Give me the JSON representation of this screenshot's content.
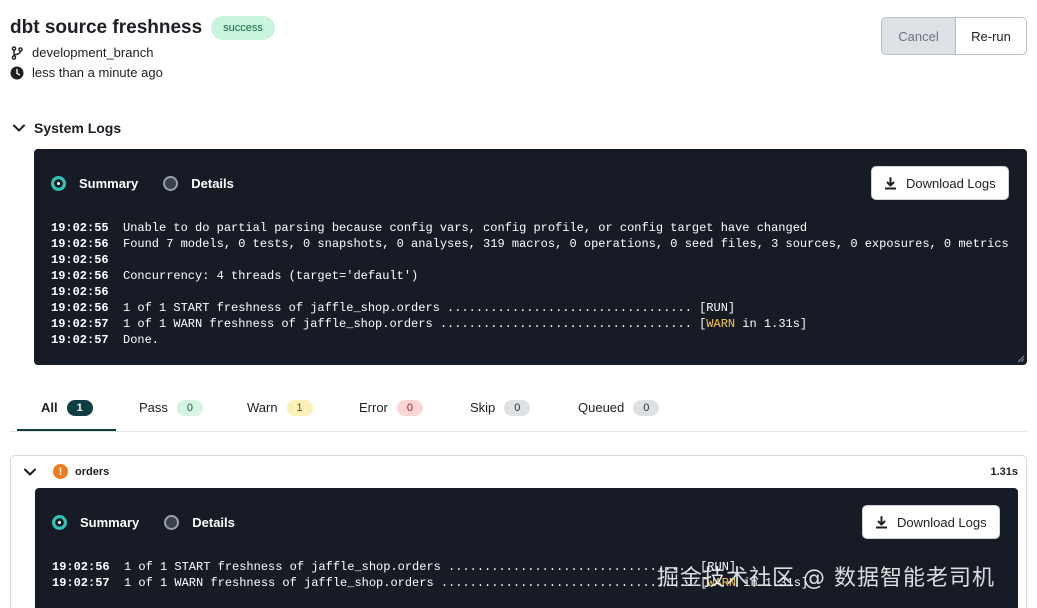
{
  "header": {
    "title": "dbt source freshness",
    "status": "success",
    "branch": "development_branch",
    "time": "less than a minute ago"
  },
  "actions": {
    "cancel_label": "Cancel",
    "rerun_label": "Re-run"
  },
  "system_logs": {
    "title": "System Logs",
    "summary_label": "Summary",
    "details_label": "Details",
    "download_label": "Download Logs",
    "lines": [
      {
        "ts": "19:02:55",
        "msg": "Unable to do partial parsing because config vars, config profile, or config target have changed"
      },
      {
        "ts": "19:02:56",
        "msg": "Found 7 models, 0 tests, 0 snapshots, 0 analyses, 319 macros, 0 operations, 0 seed files, 3 sources, 0 exposures, 0 metrics"
      },
      {
        "ts": "19:02:56",
        "msg": ""
      },
      {
        "ts": "19:02:56",
        "msg": "Concurrency: 4 threads (target='default')"
      },
      {
        "ts": "19:02:56",
        "msg": ""
      },
      {
        "ts": "19:02:56",
        "msg": "1 of 1 START freshness of jaffle_shop.orders .................................. [RUN]"
      },
      {
        "ts": "19:02:57",
        "msg": "1 of 1 WARN freshness of jaffle_shop.orders ................................... [",
        "hl": "WARN",
        "tail": " in 1.31s]"
      },
      {
        "ts": "19:02:57",
        "msg": "Done."
      }
    ]
  },
  "tabs": [
    {
      "label": "All",
      "count": "1"
    },
    {
      "label": "Pass",
      "count": "0"
    },
    {
      "label": "Warn",
      "count": "1"
    },
    {
      "label": "Error",
      "count": "0"
    },
    {
      "label": "Skip",
      "count": "0"
    },
    {
      "label": "Queued",
      "count": "0"
    }
  ],
  "result": {
    "node": "orders",
    "duration": "1.31s",
    "summary_label": "Summary",
    "details_label": "Details",
    "download_label": "Download Logs",
    "lines": [
      {
        "ts": "19:02:56",
        "msg": "1 of 1 START freshness of jaffle_shop.orders .................................. [RUN]"
      },
      {
        "ts": "19:02:57",
        "msg": "1 of 1 WARN freshness of jaffle_shop.orders ................................... [",
        "hl": "WARN",
        "tail": " in 1.31s]"
      }
    ]
  },
  "watermark": "掘金技术社区 @ 数据智能老司机",
  "colors": {
    "accent": "#2dc4b7",
    "panel_bg": "#161b26",
    "warn": "#f7c948",
    "warn_icon": "#ef7c1d",
    "tab_active": "#0f3d45"
  }
}
